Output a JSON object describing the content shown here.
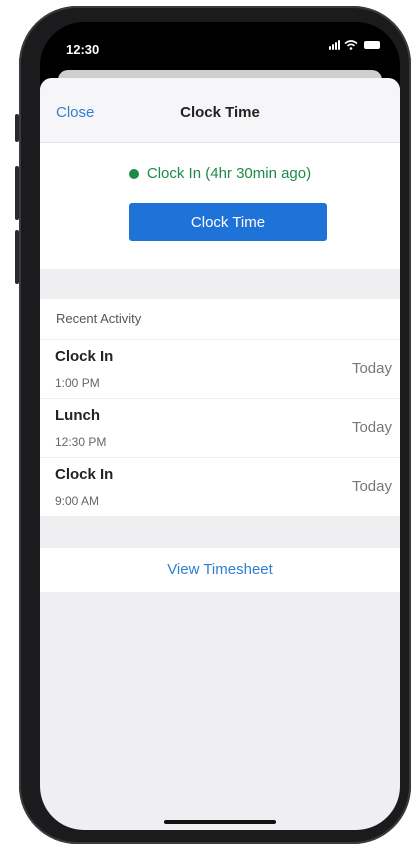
{
  "status_bar": {
    "time": "12:30"
  },
  "navbar": {
    "close_label": "Close",
    "title": "Clock Time"
  },
  "clock": {
    "status_text": "Clock In (4hr 30min ago)",
    "button_label": "Clock Time",
    "status_color": "#1e8a47",
    "button_color": "#1f73d8"
  },
  "recent_activity": {
    "header": "Recent Activity",
    "items": [
      {
        "title": "Clock In",
        "time": "1:00 PM",
        "date": "Today"
      },
      {
        "title": "Lunch",
        "time": "12:30 PM",
        "date": "Today"
      },
      {
        "title": "Clock In",
        "time": "9:00 AM",
        "date": "Today"
      }
    ]
  },
  "footer": {
    "link_label": "View Timesheet"
  },
  "icons": [
    "signal-icon",
    "wifi-icon",
    "battery-icon",
    "status-dot-icon"
  ],
  "colors": {
    "accent": "#2f7fd3",
    "success": "#1e8a47"
  }
}
